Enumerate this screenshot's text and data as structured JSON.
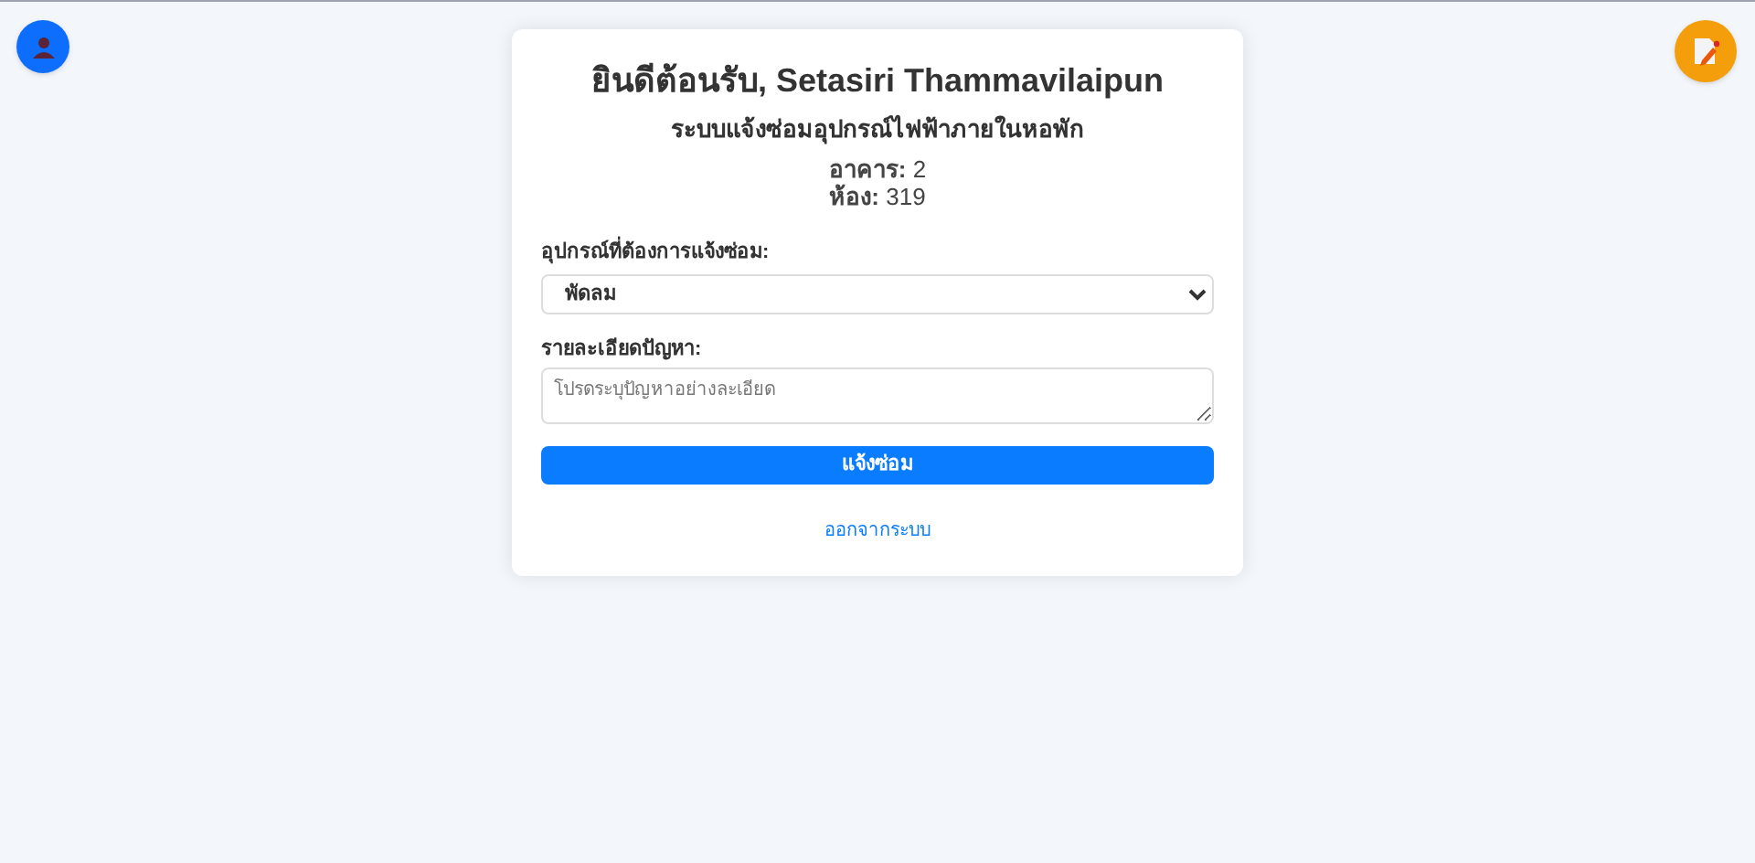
{
  "title": "ยินดีต้อนรับ, Setasiri Thammavilaipun",
  "subtitle": "ระบบแจ้งซ่อมอุปกรณ์ไฟฟ้าภายในหอพัก",
  "info": [
    "**อาคาร:** 2",
    "**ห้อง:** 319"
  ],
  "device_field": {
    "label": "อุปกรณ์ที่ต้องการแจ้งซ่อม:",
    "value": "พัดลม"
  },
  "details_field": {
    "label": "รายละเอียดปัญหา:",
    "placeholder": "โปรดระบุปัญหาอย่างละเอียด"
  },
  "submit_button": "แจ้งซ่อม",
  "logout_link": "ออกจากระบบ"
}
